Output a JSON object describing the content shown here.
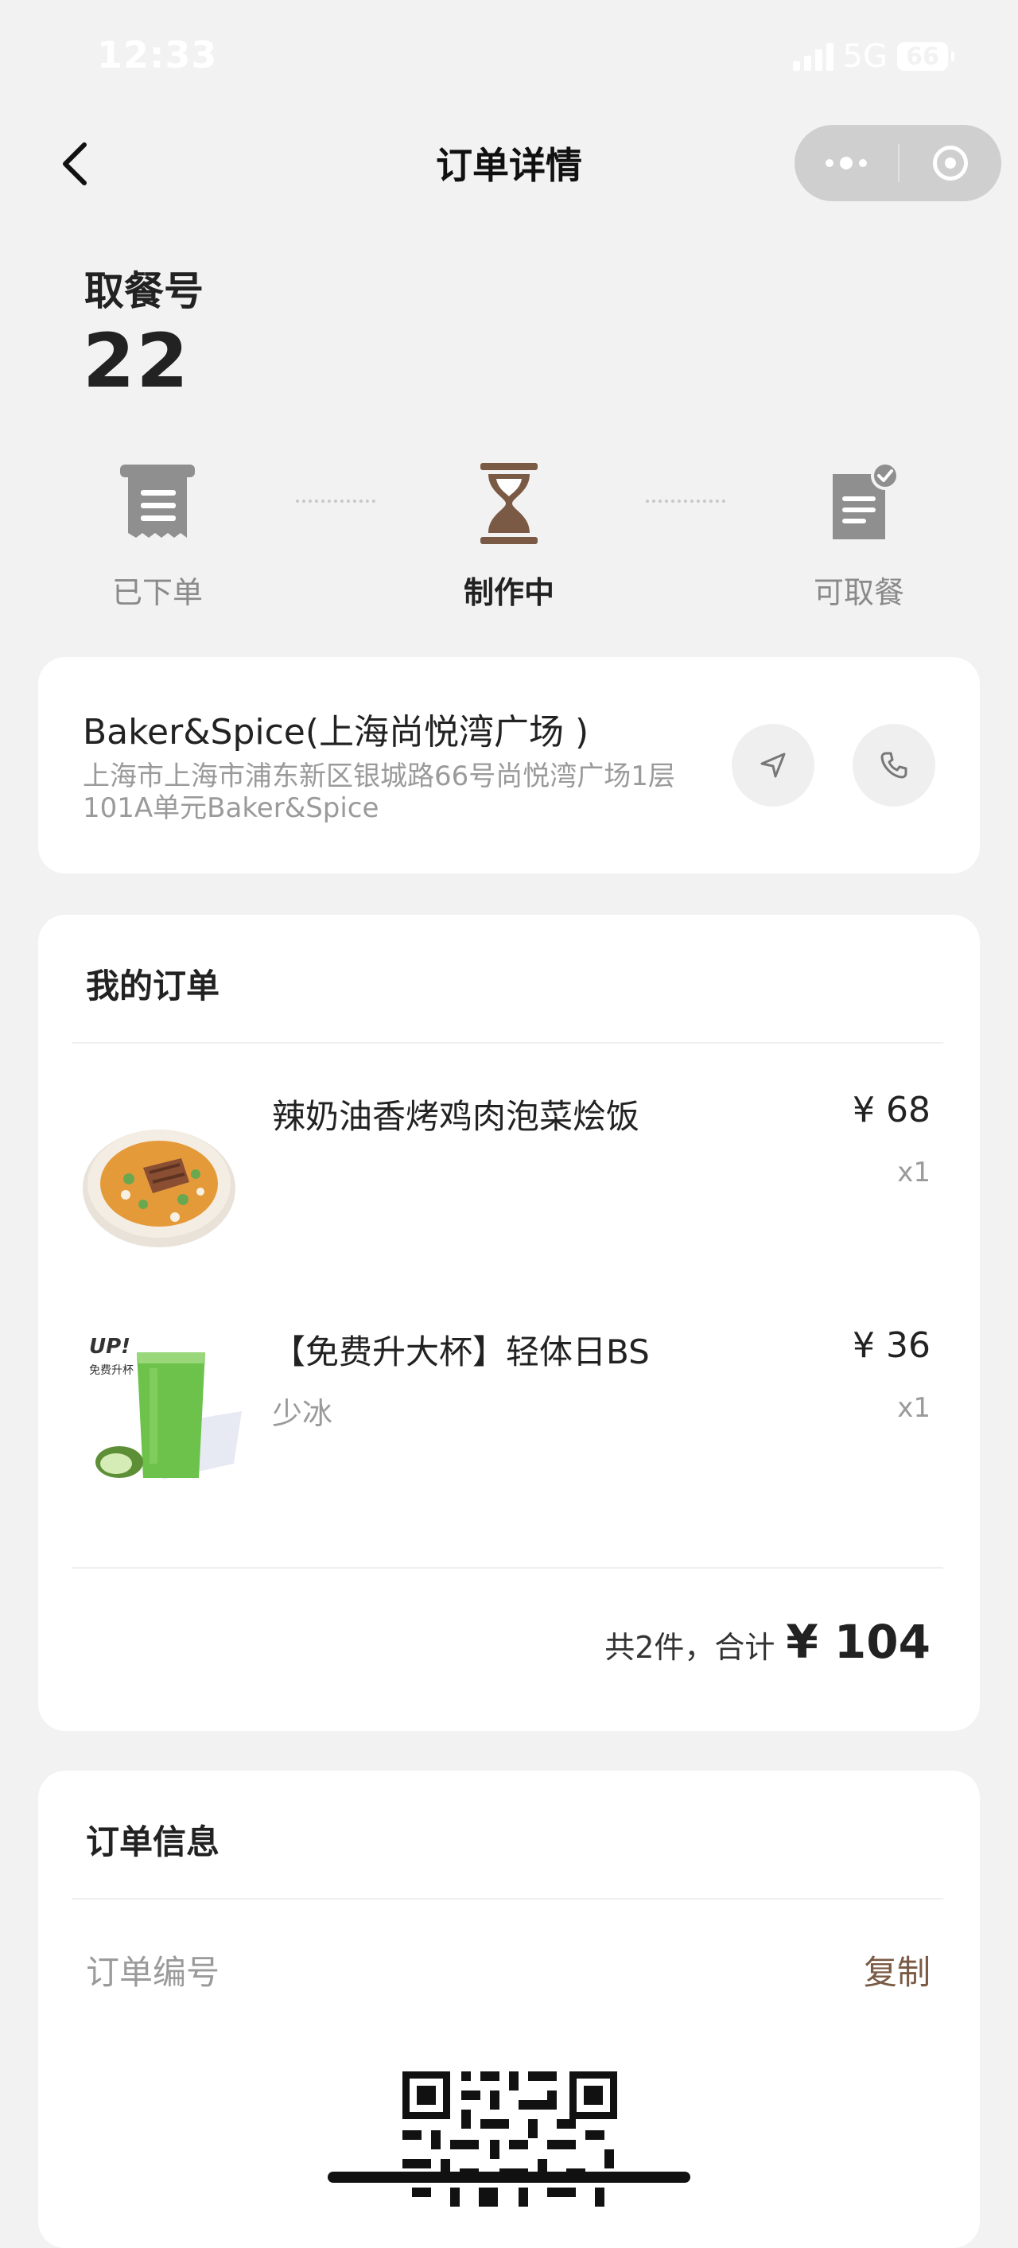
{
  "status_bar": {
    "time": "12:33",
    "network": "5G",
    "battery": "66"
  },
  "nav": {
    "title": "订单详情"
  },
  "pickup": {
    "label": "取餐号",
    "number": "22"
  },
  "progress": {
    "steps": [
      {
        "label": "已下单",
        "active": false
      },
      {
        "label": "制作中",
        "active": true
      },
      {
        "label": "可取餐",
        "active": false
      }
    ]
  },
  "store": {
    "name": "Baker&Spice(上海尚悦湾广场 )",
    "address": "上海市上海市浦东新区银城路66号尚悦湾广场1层101A单元Baker&Spice"
  },
  "order": {
    "title": "我的订单",
    "items": [
      {
        "name": "辣奶油香烤鸡肉泡菜烩饭",
        "spec": "",
        "price": "¥ 68",
        "qty": "x1"
      },
      {
        "name": "【免费升大杯】轻体日BS",
        "spec": "少冰",
        "price": "¥ 36",
        "qty": "x1",
        "badge_line1": "UP!",
        "badge_line2": "免费升杯"
      }
    ],
    "summary_label": "共2件，合计",
    "total": "¥ 104"
  },
  "order_info": {
    "title": "订单信息",
    "order_no_label": "订单编号",
    "copy_label": "复制"
  },
  "colors": {
    "accent": "#7a5a44",
    "background": "#f2f2f2",
    "card": "#ffffff"
  }
}
